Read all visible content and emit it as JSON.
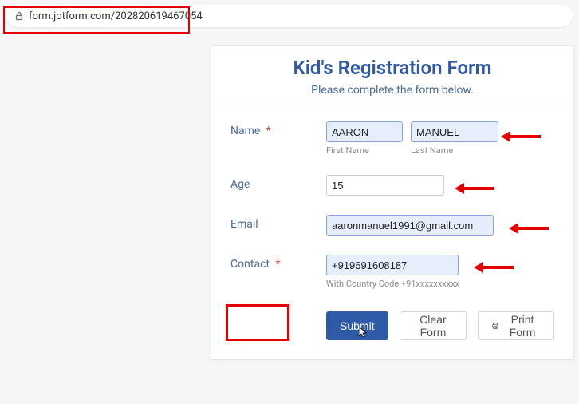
{
  "address_bar": {
    "url": "form.jotform.com/202820619467054"
  },
  "header": {
    "title": "Kid's Registration Form",
    "subtitle": "Please complete the form below."
  },
  "fields": {
    "name": {
      "label": "Name",
      "required_marker": "*",
      "first": "AARON",
      "last": "MANUEL",
      "first_sublabel": "First Name",
      "last_sublabel": "Last Name"
    },
    "age": {
      "label": "Age",
      "value": "15"
    },
    "email": {
      "label": "Email",
      "value": "aaronmanuel1991@gmail.com"
    },
    "contact": {
      "label": "Contact",
      "required_marker": "*",
      "value": "+919691608187",
      "sublabel": "With Country Code +91xxxxxxxxxx"
    }
  },
  "buttons": {
    "submit": "Submit",
    "clear": "Clear Form",
    "print": "Print Form"
  }
}
